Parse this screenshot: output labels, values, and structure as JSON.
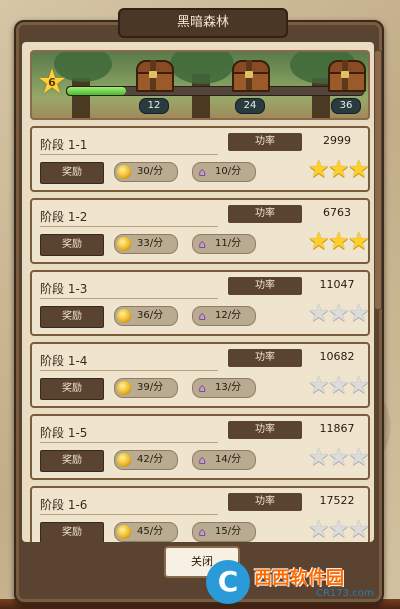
{
  "title": "黑暗森林",
  "level": "6",
  "progress": 0.2,
  "chests": [
    {
      "count": "12"
    },
    {
      "count": "24"
    },
    {
      "count": "36"
    }
  ],
  "power_label": "功率",
  "reward_label": "奖励",
  "stages": [
    {
      "name": "阶段 1-1",
      "power": "2999",
      "coins": "30/分",
      "gems": "10/分",
      "stars": 3
    },
    {
      "name": "阶段 1-2",
      "power": "6763",
      "coins": "33/分",
      "gems": "11/分",
      "stars": 3
    },
    {
      "name": "阶段 1-3",
      "power": "11047",
      "coins": "36/分",
      "gems": "12/分",
      "stars": 0
    },
    {
      "name": "阶段 1-4",
      "power": "10682",
      "coins": "39/分",
      "gems": "13/分",
      "stars": 0
    },
    {
      "name": "阶段 1-5",
      "power": "11867",
      "coins": "42/分",
      "gems": "14/分",
      "stars": 0
    },
    {
      "name": "阶段 1-6",
      "power": "17522",
      "coins": "45/分",
      "gems": "15/分",
      "stars": 0
    }
  ],
  "close_label": "关闭",
  "watermark": {
    "logo": "C",
    "text": "西西软件园",
    "url": "CR173.com"
  },
  "colors": {
    "frame": "#5a4330",
    "star_gold": "#ffcf2a",
    "star_gray": "#dcdcdc",
    "progress": "#4cbb2a"
  }
}
